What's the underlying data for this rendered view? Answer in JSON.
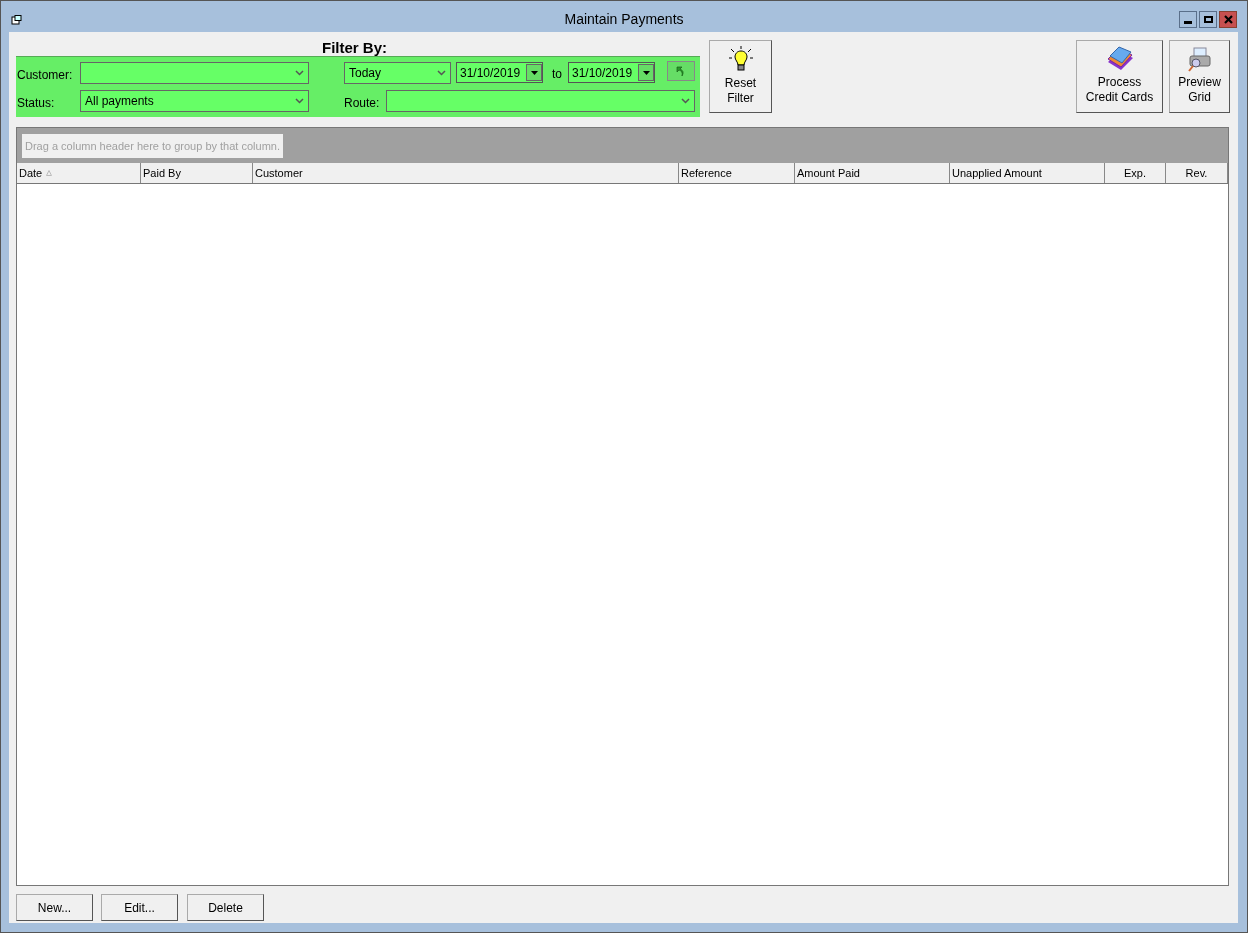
{
  "window": {
    "title": "Maintain Payments"
  },
  "filter": {
    "heading": "Filter By:",
    "customer": {
      "label": "Customer:"
    },
    "status": {
      "label": "Status:",
      "value": "All payments"
    },
    "period": {
      "value": "Today"
    },
    "date_from": "31/10/2019",
    "to_label": "to",
    "date_to": "31/10/2019",
    "route": {
      "label": "Route:"
    }
  },
  "reset_button": [
    "Reset",
    "Filter"
  ],
  "process_button": [
    "Process",
    "Credit Cards"
  ],
  "preview_button": [
    "Preview",
    "Grid"
  ],
  "grid": {
    "group_hint": "Drag a column header here to group by that column.",
    "columns": [
      {
        "label": "Date",
        "sorted": true,
        "kind": "text"
      },
      {
        "label": "Paid By",
        "sorted": false,
        "kind": "text"
      },
      {
        "label": "Customer",
        "sorted": false,
        "kind": "text"
      },
      {
        "label": "Reference",
        "sorted": false,
        "kind": "text"
      },
      {
        "label": "Amount Paid",
        "sorted": false,
        "kind": "text"
      },
      {
        "label": "Unapplied Amount",
        "sorted": false,
        "kind": "text"
      },
      {
        "label": "Exp.",
        "sorted": false,
        "kind": "flag"
      },
      {
        "label": "Rev.",
        "sorted": false,
        "kind": "flag"
      }
    ]
  },
  "buttons": [
    "New...",
    "Edit...",
    "Delete"
  ]
}
